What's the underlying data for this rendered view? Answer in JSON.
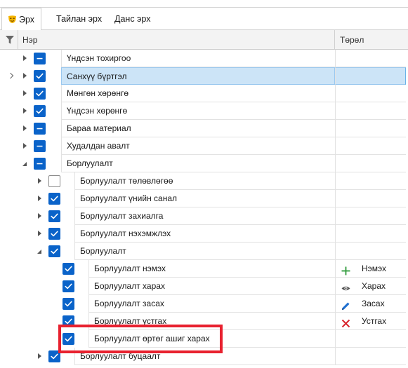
{
  "tabs": [
    {
      "label": "Эрх",
      "active": true,
      "icon": "mask-icon"
    },
    {
      "label": "Тайлан эрх",
      "active": false
    },
    {
      "label": "Данс эрх",
      "active": false
    }
  ],
  "columns": {
    "name": "Нэр",
    "type": "Төрөл"
  },
  "rows": [
    {
      "label": "Үндсэн тохиргоо",
      "level": 0,
      "expander": "collapsed",
      "check": "partial"
    },
    {
      "label": "Санхүү бүртгэл",
      "level": 0,
      "expander": "collapsed",
      "check": "checked",
      "selected": true
    },
    {
      "label": "Мөнгөн хөрөнгө",
      "level": 0,
      "expander": "collapsed",
      "check": "checked"
    },
    {
      "label": "Үндсэн хөрөнгө",
      "level": 0,
      "expander": "collapsed",
      "check": "checked"
    },
    {
      "label": "Бараа материал",
      "level": 0,
      "expander": "collapsed",
      "check": "partial"
    },
    {
      "label": "Худалдан авалт",
      "level": 0,
      "expander": "collapsed",
      "check": "partial"
    },
    {
      "label": "Борлуулалт",
      "level": 0,
      "expander": "expanded",
      "check": "partial"
    },
    {
      "label": "Борлуулалт төлөвлөгөө",
      "level": 1,
      "expander": "collapsed",
      "check": "unchecked"
    },
    {
      "label": "Борлуулалт үнийн санал",
      "level": 1,
      "expander": "collapsed",
      "check": "checked"
    },
    {
      "label": "Борлуулалт захиалга",
      "level": 1,
      "expander": "collapsed",
      "check": "checked"
    },
    {
      "label": "Борлуулалт нэхэмжлэх",
      "level": 1,
      "expander": "collapsed",
      "check": "checked"
    },
    {
      "label": "Борлуулалт",
      "level": 1,
      "expander": "expanded",
      "check": "checked"
    },
    {
      "label": "Борлуулалт нэмэх",
      "level": 2,
      "check": "checked",
      "type": "Нэмэх",
      "type_icon": "plus-icon"
    },
    {
      "label": "Борлуулалт харах",
      "level": 2,
      "check": "checked",
      "type": "Харах",
      "type_icon": "eye-icon"
    },
    {
      "label": "Борлуулалт засах",
      "level": 2,
      "check": "checked",
      "type": "Засах",
      "type_icon": "pencil-icon"
    },
    {
      "label": "Борлуулалт устгах",
      "level": 2,
      "check": "checked",
      "type": "Устгах",
      "type_icon": "x-icon"
    },
    {
      "label": "Борлуулалт өртөг ашиг харах",
      "level": 2,
      "check": "checked",
      "type": "",
      "highlighted": true
    },
    {
      "label": "Борлуулалт буцаалт",
      "level": 1,
      "expander": "collapsed",
      "check": "checked"
    }
  ],
  "colors": {
    "accent": "#0a63c9",
    "selection": "#cce4f7",
    "highlight": "#e8212f",
    "plus": "#2e9b3a",
    "x": "#d8262e",
    "pencil": "#1e6fd0",
    "eye": "#555555",
    "mask": "#f4b400"
  }
}
